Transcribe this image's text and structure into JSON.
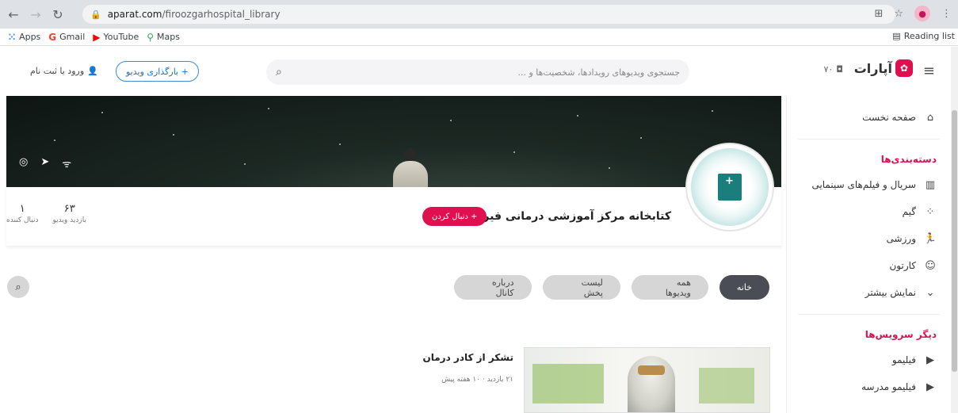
{
  "browser": {
    "url_host": "aparat.com",
    "url_path": "/firoozgarhospital_library",
    "bookmarks": [
      "Apps",
      "Gmail",
      "YouTube",
      "Maps"
    ],
    "reading_list": "Reading list"
  },
  "header": {
    "logo_text": "آپارات",
    "live_count": "۷۰",
    "search_placeholder": "جستجوی ویدیوهای رویدادها، شخصیت‌ها و ...",
    "upload_label": "+ بارگذاری ویدیو",
    "login_label": "ورود یا ثبت نام"
  },
  "sidebar": {
    "home": "صفحه نخست",
    "categories_heading": "دسته‌بندی‌ها",
    "categories": [
      {
        "label": "سریال و فیلم‌های سینمایی",
        "icon": "film-icon"
      },
      {
        "label": "گیم",
        "icon": "game-icon"
      },
      {
        "label": "ورزشی",
        "icon": "sport-icon"
      },
      {
        "label": "کارتون",
        "icon": "cartoon-icon"
      }
    ],
    "show_more": "نمایش بیشتر",
    "services_heading": "دیگر سرویس‌ها",
    "services": [
      {
        "label": "فیلیمو",
        "icon": "filimo-icon"
      },
      {
        "label": "فیلیمو مدرسه",
        "icon": "filimo-school-icon"
      }
    ]
  },
  "channel": {
    "name": "کتابخانه مرکز آموزشی درمانی فیروزگر",
    "follow_label": "+ دنبال کردن",
    "followers_value": "۱",
    "followers_label": "دنبال کننده",
    "views_value": "۶۳",
    "views_label": "بازدید ویدیو"
  },
  "tabs": [
    {
      "label": "خانه",
      "active": true
    },
    {
      "label": "همه ویدیوها",
      "active": false
    },
    {
      "label": "لیست پخش",
      "active": false
    },
    {
      "label": "درباره کانال",
      "active": false
    }
  ],
  "video": {
    "title": "تشکر از کادر درمان",
    "meta": "۲۱ بازدید · ۱۰ هفته پیش"
  },
  "colors": {
    "brand": "#df0f50",
    "upload_border": "#3b8bdc",
    "active_tab": "#4a4d55"
  }
}
